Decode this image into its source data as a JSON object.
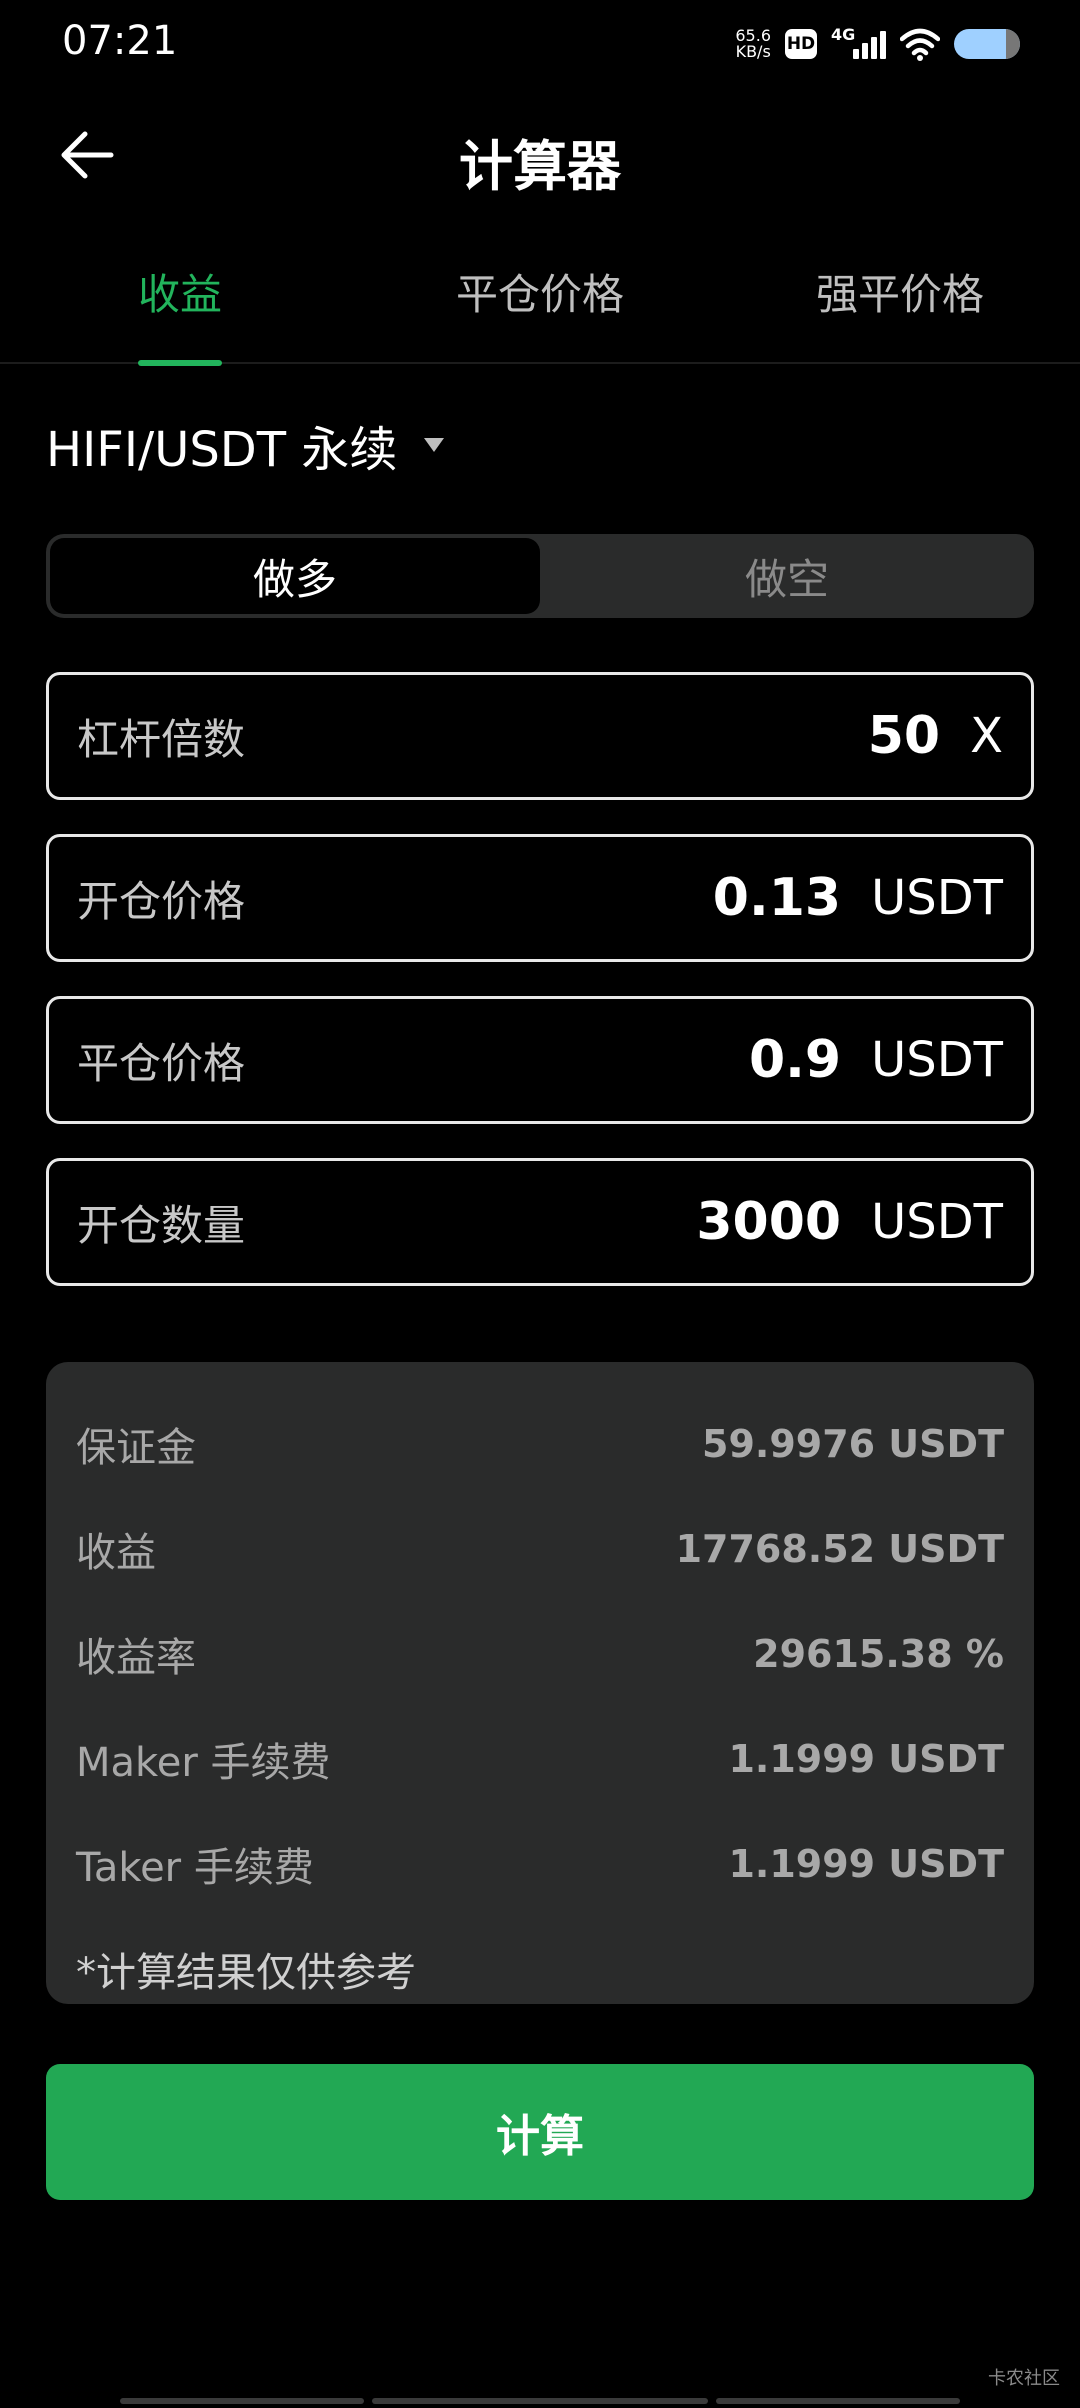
{
  "status_bar": {
    "time": "07:21",
    "net_speed_value": "65.6",
    "net_speed_unit": "KB/s",
    "hd_label": "HD",
    "signal_label": "4G"
  },
  "header": {
    "title": "计算器",
    "back_icon": "arrow-left-icon"
  },
  "tabs": [
    {
      "label": "收益",
      "active": true
    },
    {
      "label": "平仓价格",
      "active": false
    },
    {
      "label": "强平价格",
      "active": false
    }
  ],
  "pair": {
    "label": "HIFI/USDT 永续",
    "dropdown_icon": "caret-down-icon"
  },
  "direction": {
    "long_label": "做多",
    "short_label": "做空",
    "selected": "做多"
  },
  "fields": {
    "leverage": {
      "label": "杠杆倍数",
      "value": "50",
      "unit": "X"
    },
    "open_price": {
      "label": "开仓价格",
      "value": "0.13",
      "unit": "USDT"
    },
    "close_price": {
      "label": "平仓价格",
      "value": "0.9",
      "unit": "USDT"
    },
    "quantity": {
      "label": "开仓数量",
      "value": "3000",
      "unit": "USDT"
    }
  },
  "results": {
    "margin": {
      "label": "保证金",
      "value": "59.9976 USDT"
    },
    "profit": {
      "label": "收益",
      "value": "17768.52 USDT"
    },
    "roi": {
      "label": "收益率",
      "value": "29615.38 %"
    },
    "maker_fee": {
      "label": "Maker 手续费",
      "value": "1.1999 USDT"
    },
    "taker_fee": {
      "label": "Taker 手续费",
      "value": "1.1999 USDT"
    },
    "disclaimer": "*计算结果仅供参考"
  },
  "calculate_button": "计算",
  "watermark": "卡农社区",
  "colors": {
    "accent_green": "#22b45c",
    "button_green": "#22a854",
    "card_bg": "#2a2b2b"
  }
}
